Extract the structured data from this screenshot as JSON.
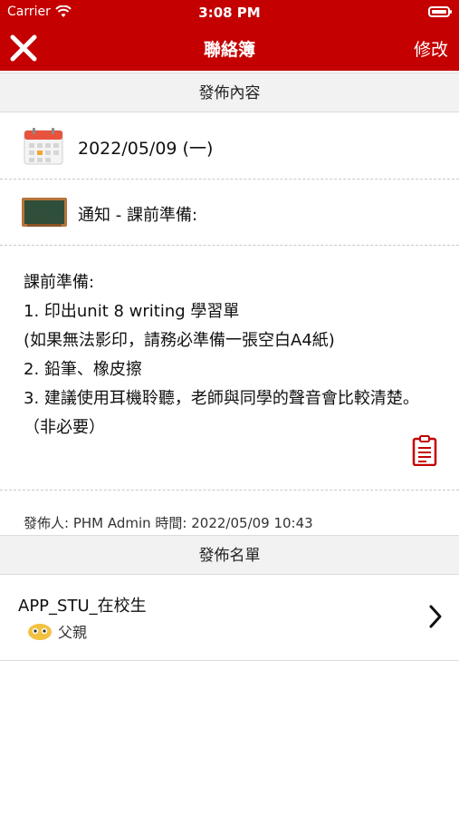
{
  "status_bar": {
    "carrier": "Carrier",
    "time": "3:08 PM"
  },
  "nav": {
    "title": "聯絡簿",
    "edit_label": "修改",
    "accent_color": "#c40000"
  },
  "publish_section": {
    "header": "發佈內容",
    "date": "2022/05/09 (一)",
    "type": "通知 - 課前準備:",
    "body": "課前準備:\n1. 印出unit 8 writing 學習單\n(如果無法影印，請務必準備一張空白A4紙)\n2. 鉛筆、橡皮擦\n3. 建議使用耳機聆聽，老師與同學的聲音會比較清楚。（非必要）",
    "poster": "發佈人: PHM Admin 時間: 2022/05/09 10:43"
  },
  "recipients_section": {
    "header": "發佈名單",
    "items": [
      {
        "name": "APP_STU_在校生",
        "role": "父親"
      }
    ]
  },
  "icons": [
    "wifi-icon",
    "battery-icon",
    "close-icon",
    "calendar-icon",
    "blackboard-icon",
    "clipboard-icon",
    "parent-avatar-icon",
    "chevron-right-icon"
  ]
}
